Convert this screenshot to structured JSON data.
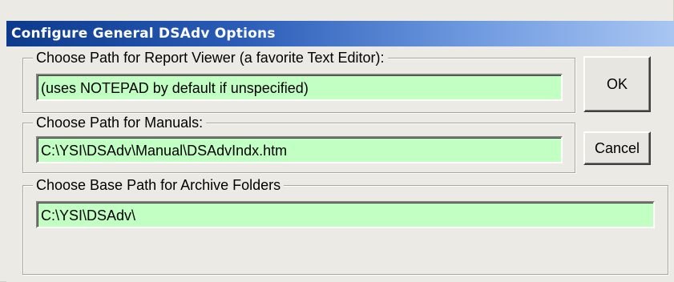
{
  "window": {
    "title": "Configure General DSAdv Options"
  },
  "groups": {
    "report_viewer": {
      "label": "Choose Path for Report Viewer (a favorite Text Editor):",
      "value": "(uses NOTEPAD by default if unspecified)"
    },
    "manuals": {
      "label": "Choose Path for Manuals:",
      "value": "C:\\YSI\\DSAdv\\Manual\\DSAdvIndx.htm"
    },
    "archive": {
      "label": "Choose Base Path for Archive Folders",
      "value": "C:\\YSI\\DSAdv\\"
    }
  },
  "buttons": {
    "ok_label": "OK",
    "cancel_label": "Cancel"
  },
  "colors": {
    "field_background": "#c2ffc2",
    "titlebar_start": "#0c3a8c",
    "titlebar_end": "#a9c6f2"
  }
}
